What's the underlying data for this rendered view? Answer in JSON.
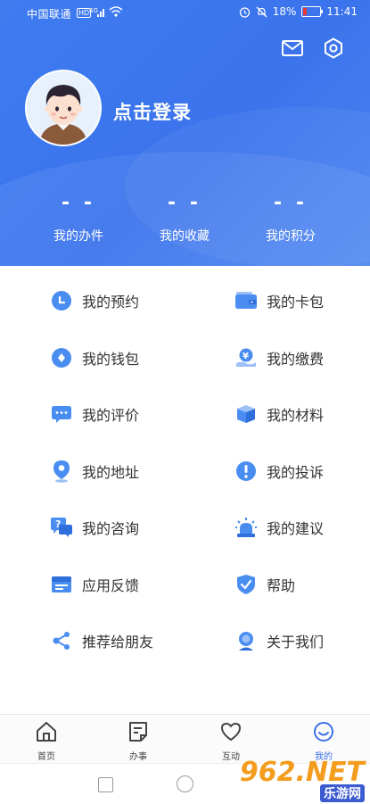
{
  "status_bar": {
    "carrier": "中国联通",
    "hd": "HD",
    "battery": "18%",
    "time": "11:41"
  },
  "profile": {
    "login_text": "点击登录"
  },
  "stats": [
    {
      "value": "- -",
      "label": "我的办件"
    },
    {
      "value": "- -",
      "label": "我的收藏"
    },
    {
      "value": "- -",
      "label": "我的积分"
    }
  ],
  "menu": {
    "left": [
      {
        "label": "我的预约",
        "icon": "clock-icon"
      },
      {
        "label": "我的钱包",
        "icon": "wallet-coin-icon"
      },
      {
        "label": "我的评价",
        "icon": "chat-bubble-icon"
      },
      {
        "label": "我的地址",
        "icon": "location-pin-icon"
      },
      {
        "label": "我的咨询",
        "icon": "question-chat-icon"
      },
      {
        "label": "应用反馈",
        "icon": "feedback-icon"
      },
      {
        "label": "推荐给朋友",
        "icon": "share-icon"
      }
    ],
    "right": [
      {
        "label": "我的卡包",
        "icon": "card-wallet-icon"
      },
      {
        "label": "我的缴费",
        "icon": "payment-icon"
      },
      {
        "label": "我的材料",
        "icon": "box-icon"
      },
      {
        "label": "我的投诉",
        "icon": "exclamation-shield-icon"
      },
      {
        "label": "我的建议",
        "icon": "alarm-light-icon"
      },
      {
        "label": "帮助",
        "icon": "shield-check-icon"
      },
      {
        "label": "关于我们",
        "icon": "service-agent-icon"
      }
    ]
  },
  "bottom_nav": [
    {
      "label": "首页",
      "icon": "home-icon",
      "active": false
    },
    {
      "label": "办事",
      "icon": "document-icon",
      "active": false
    },
    {
      "label": "互动",
      "icon": "heart-icon",
      "active": false
    },
    {
      "label": "我的",
      "icon": "smiley-icon",
      "active": true
    }
  ],
  "watermark": {
    "top": "962.NET",
    "bottom": "乐游网"
  },
  "colors": {
    "primary": "#3d72e8",
    "header_start": "#3e7cf0",
    "icon_blue": "#4a8df0",
    "text": "#333333"
  }
}
